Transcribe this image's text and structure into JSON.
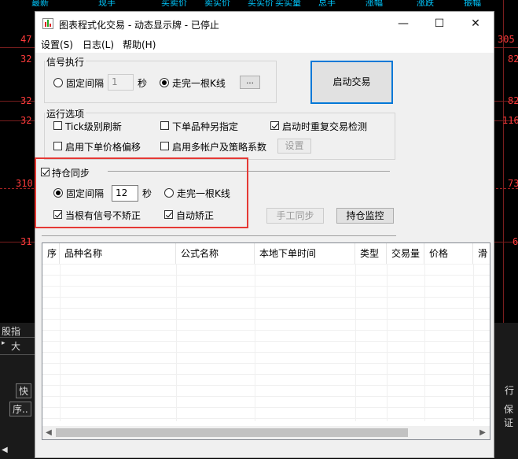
{
  "background": {
    "top_strip": [
      "最新",
      "现手",
      "买卖价",
      "卖实价",
      "买实价",
      "买实量",
      "总手",
      "涨幅",
      "涨跌",
      "振幅"
    ],
    "left_prices": [
      "47",
      "32",
      "32",
      "32",
      "310",
      "31"
    ],
    "right_prices": [
      "305",
      "82",
      "82",
      "116",
      "73",
      "6"
    ],
    "left_tab": "股指",
    "left_big": "大",
    "btn_quick": "快",
    "btn_seq": "序..",
    "right_label": "保证",
    "right_tab": "行",
    "left_arrow": "◀"
  },
  "window": {
    "title": "图表程式化交易 - 动态显示牌 - 已停止",
    "controls": {
      "minimize": "—",
      "maximize": "☐",
      "close": "✕"
    },
    "menu": [
      "设置(S)",
      "日志(L)",
      "帮助(H)"
    ],
    "signal_group": {
      "title": "信号执行",
      "fixed_interval_label": "固定间隔",
      "interval_value": "1",
      "sec_label": "秒",
      "kline_label": "走完一根K线",
      "more_button": "...",
      "selected": "kline"
    },
    "start_button": "启动交易",
    "options_group": {
      "title": "运行选项",
      "items": [
        {
          "label": "Tick级别刷新",
          "checked": false
        },
        {
          "label": "下单品种另指定",
          "checked": false
        },
        {
          "label": "启动时重复交易检测",
          "checked": true
        },
        {
          "label": "启用下单价格偏移",
          "checked": false
        },
        {
          "label": "启用多帐户及策略系数",
          "checked": false
        }
      ],
      "settings_button": "设置"
    },
    "position_sync": {
      "title": "持仓同步",
      "checked": true,
      "fixed_interval_label": "固定间隔",
      "interval_value": "12",
      "sec_label": "秒",
      "kline_label": "走完一根K线",
      "selected": "fixed",
      "no_correct_label": "当根有信号不矫正",
      "no_correct_checked": true,
      "auto_correct_label": "自动矫正",
      "auto_correct_checked": true,
      "manual_sync_button": "手工同步",
      "monitor_button": "持仓监控"
    },
    "table": {
      "columns": [
        "序",
        "品种名称",
        "公式名称",
        "本地下单时间",
        "类型",
        "交易量",
        "价格",
        "滑"
      ],
      "rows": []
    },
    "colors": {
      "highlight": "#e53935",
      "accent": "#0078d7"
    }
  }
}
